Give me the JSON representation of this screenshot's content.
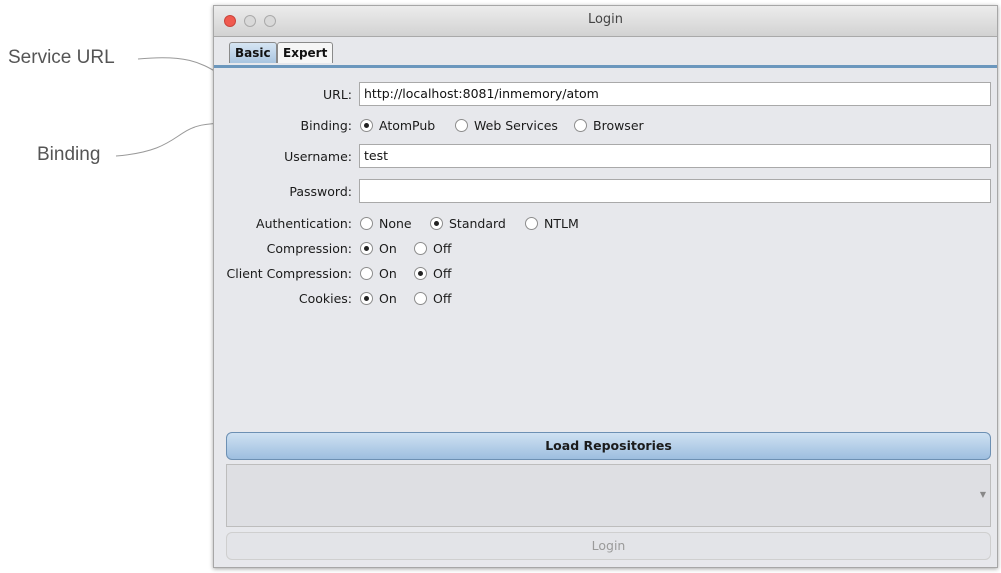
{
  "annotations": {
    "service_url": "Service URL",
    "binding": "Binding"
  },
  "window": {
    "title": "Login",
    "tabs": [
      {
        "label": "Basic",
        "active": true
      },
      {
        "label": "Expert",
        "active": false
      }
    ]
  },
  "form": {
    "url": {
      "label": "URL:",
      "value": "http://localhost:8081/inmemory/atom"
    },
    "binding": {
      "label": "Binding:",
      "options": [
        "AtomPub",
        "Web Services",
        "Browser"
      ],
      "selected": "AtomPub"
    },
    "username": {
      "label": "Username:",
      "value": "test"
    },
    "password": {
      "label": "Password:",
      "value": ""
    },
    "authentication": {
      "label": "Authentication:",
      "options": [
        "None",
        "Standard",
        "NTLM"
      ],
      "selected": "Standard"
    },
    "compression": {
      "label": "Compression:",
      "options": [
        "On",
        "Off"
      ],
      "selected": "On"
    },
    "client_compression": {
      "label": "Client Compression:",
      "options": [
        "On",
        "Off"
      ],
      "selected": "Off"
    },
    "cookies": {
      "label": "Cookies:",
      "options": [
        "On",
        "Off"
      ],
      "selected": "On"
    }
  },
  "buttons": {
    "load_repositories": "Load Repositories",
    "login": "Login"
  },
  "colors": {
    "accent": "#6b97bd",
    "close_light": "#f05a4f"
  }
}
